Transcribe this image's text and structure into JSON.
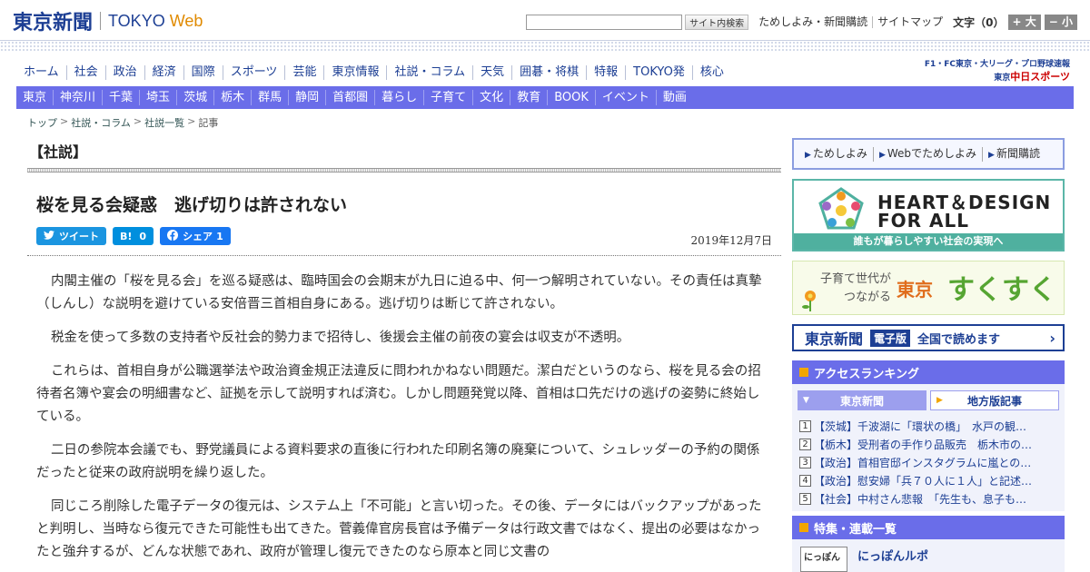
{
  "header": {
    "logo_main": "東京新聞",
    "logo_tokyo": "TOKYO",
    "logo_web": "Web",
    "search_placeholder": "",
    "search_button": "サイト内検索",
    "links": [
      "ためしよみ・新聞購読",
      "サイトマップ"
    ],
    "font_size_label": "文字（0）",
    "font_up": "+ 大",
    "font_down": "− 小"
  },
  "main_nav": [
    "ホーム",
    "社会",
    "政治",
    "経済",
    "国際",
    "スポーツ",
    "芸能",
    "東京情報",
    "社説・コラム",
    "天気",
    "囲碁・将棋",
    "特報",
    "TOKYO発",
    "核心"
  ],
  "chunichi": {
    "top": "F1・FC東京・大リーグ・プロ野球速報",
    "prefix": "東京",
    "name": "中日スポーツ"
  },
  "sub_nav": [
    "東京",
    "神奈川",
    "千葉",
    "埼玉",
    "茨城",
    "栃木",
    "群馬",
    "静岡",
    "首都圏",
    "暮らし",
    "子育て",
    "文化",
    "教育",
    "BOOK",
    "イベント",
    "動画"
  ],
  "breadcrumb": [
    "トップ",
    "社説・コラム",
    "社説一覧",
    "記事"
  ],
  "article": {
    "section": "【社説】",
    "title": "桜を見る会疑惑　逃げ切りは許されない",
    "date": "2019年12月7日",
    "share": {
      "tweet": "ツイート",
      "hatena": "B!",
      "hatena_count": "0",
      "facebook": "シェア",
      "facebook_count": "1"
    },
    "paragraphs": [
      "内閣主催の「桜を見る会」を巡る疑惑は、臨時国会の会期末が九日に迫る中、何一つ解明されていない。その責任は真摯（しんし）な説明を避けている安倍晋三首相自身にある。逃げ切りは断じて許されない。",
      "税金を使って多数の支持者や反社会的勢力まで招待し、後援会主催の前夜の宴会は収支が不透明。",
      "これらは、首相自身が公職選挙法や政治資金規正法違反に問われかねない問題だ。潔白だというのなら、桜を見る会の招待者名簿や宴会の明細書など、証拠を示して説明すれば済む。しかし問題発覚以降、首相は口先だけの逃げの姿勢に終始している。",
      "二日の参院本会議でも、野党議員による資料要求の直後に行われた印刷名簿の廃棄について、シュレッダーの予約の関係だったと従来の政府説明を繰り返した。",
      "同じころ削除した電子データの復元は、システム上「不可能」と言い切った。その後、データにはバックアップがあったと判明し、当時なら復元できた可能性も出てきた。菅義偉官房長官は予備データは行政文書ではなく、提出の必要はなかったと強弁するが、どんな状態であれ、政府が管理し復元できたのなら原本と同じ文書の"
    ]
  },
  "sidebar": {
    "subscribe_links": [
      "ためしよみ",
      "Webでためしよみ",
      "新聞購読"
    ],
    "heart": {
      "line1": "HEART＆DESIGN",
      "line2": "FOR ALL",
      "caption": "誰もが暮らしやすい社会の実現へ"
    },
    "sukusuku": {
      "small1": "子育て世代が",
      "small2": "つながる",
      "tokyo": "東京",
      "big": "すくすく"
    },
    "denshi": {
      "logo": "東京新聞",
      "tag": "電子版",
      "text": "全国で読めます",
      "arrow": "›"
    },
    "ranking": {
      "title": "アクセスランキング",
      "tab1": "東京新聞",
      "tab2": "地方版記事",
      "items": [
        {
          "num": "1",
          "text": "【茨城】千波湖に「環状の橋」　水戸の観…"
        },
        {
          "num": "2",
          "text": "【栃木】受刑者の手作り品販売　栃木市の…"
        },
        {
          "num": "3",
          "text": "【政治】首相官邸インスタグラムに嵐との…"
        },
        {
          "num": "4",
          "text": "【政治】慰安婦「兵７０人に１人」と記述…"
        },
        {
          "num": "5",
          "text": "【社会】中村さん悲報　「先生も、息子も…"
        }
      ]
    },
    "features": {
      "title": "特集・連載一覧",
      "thumb": "にっぽん",
      "item_title": "にっぽんルポ"
    }
  },
  "colors": {
    "brand_blue": "#1d3f94",
    "nav_purple": "#6a6de9",
    "web_orange": "#e08a00",
    "heart_teal": "#4fb09f"
  }
}
